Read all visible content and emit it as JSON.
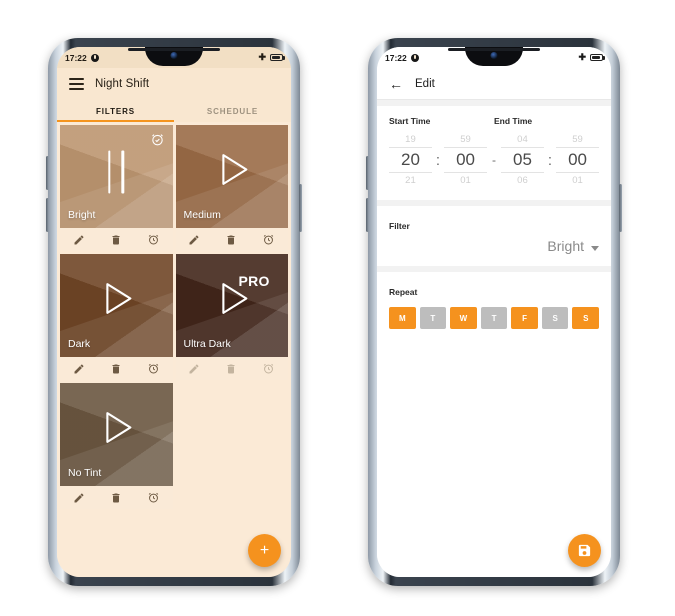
{
  "colors": {
    "accent": "#f5921e",
    "app1_bg": "#f9e7d0",
    "grid_bg": "#fbead6",
    "action_bar_bg": "#faead7",
    "day_on": "#f5921e",
    "day_off": "#bdbdbd"
  },
  "phone1": {
    "statusbar": {
      "time": "17:22",
      "left_icons": [
        "notification-dot-icon"
      ],
      "right_icons": [
        "airplane-mode-icon",
        "battery-icon"
      ]
    },
    "appbar": {
      "menu_icon": "hamburger-menu-icon",
      "title": "Night Shift"
    },
    "tabs": [
      {
        "label": "FILTERS",
        "active": true
      },
      {
        "label": "SCHEDULE",
        "active": false
      }
    ],
    "filters": [
      {
        "name": "Bright",
        "glyph": "pause-icon",
        "bg": "#bc9570",
        "scheduled": true,
        "pro": false,
        "disabled": false,
        "actions": [
          "edit-icon",
          "delete-icon",
          "alarm-icon"
        ]
      },
      {
        "name": "Medium",
        "glyph": "play-icon",
        "bg": "#9a6b46",
        "scheduled": false,
        "pro": false,
        "disabled": false,
        "actions": [
          "edit-icon",
          "delete-icon",
          "alarm-icon"
        ]
      },
      {
        "name": "Dark",
        "glyph": "play-icon",
        "bg": "#6f4526",
        "scheduled": false,
        "pro": false,
        "disabled": false,
        "actions": [
          "edit-icon",
          "delete-icon",
          "alarm-icon"
        ]
      },
      {
        "name": "Ultra Dark",
        "glyph": "play-icon",
        "bg": "#42261a",
        "scheduled": false,
        "pro": true,
        "pro_label": "PRO",
        "disabled": true,
        "actions": [
          "edit-icon",
          "delete-icon",
          "alarm-icon"
        ]
      },
      {
        "name": "No Tint",
        "glyph": "play-icon",
        "bg": "#6a5640",
        "scheduled": false,
        "pro": false,
        "disabled": false,
        "actions": [
          "edit-icon",
          "delete-icon",
          "alarm-icon"
        ]
      }
    ],
    "fab": {
      "icon": "plus-icon",
      "label": "+"
    }
  },
  "phone2": {
    "statusbar": {
      "time": "17:22",
      "left_icons": [
        "notification-dot-icon"
      ],
      "right_icons": [
        "airplane-mode-icon",
        "battery-icon"
      ]
    },
    "appbar": {
      "back_icon": "back-arrow-icon",
      "title": "Edit"
    },
    "time_section": {
      "start_label": "Start Time",
      "end_label": "End Time",
      "separator": "-",
      "colon": ":",
      "start": {
        "hour": {
          "prev": "19",
          "value": "20",
          "next": "21"
        },
        "minute": {
          "prev": "59",
          "value": "00",
          "next": "01"
        }
      },
      "end": {
        "hour": {
          "prev": "04",
          "value": "05",
          "next": "06"
        },
        "minute": {
          "prev": "59",
          "value": "00",
          "next": "01"
        }
      }
    },
    "filter_section": {
      "label": "Filter",
      "value": "Bright",
      "caret_icon": "chevron-down-icon"
    },
    "repeat_section": {
      "label": "Repeat",
      "days": [
        {
          "label": "M",
          "selected": true
        },
        {
          "label": "T",
          "selected": false
        },
        {
          "label": "W",
          "selected": true
        },
        {
          "label": "T",
          "selected": false
        },
        {
          "label": "F",
          "selected": true
        },
        {
          "label": "S",
          "selected": false
        },
        {
          "label": "S",
          "selected": true
        }
      ]
    },
    "fab": {
      "icon": "save-icon"
    }
  }
}
